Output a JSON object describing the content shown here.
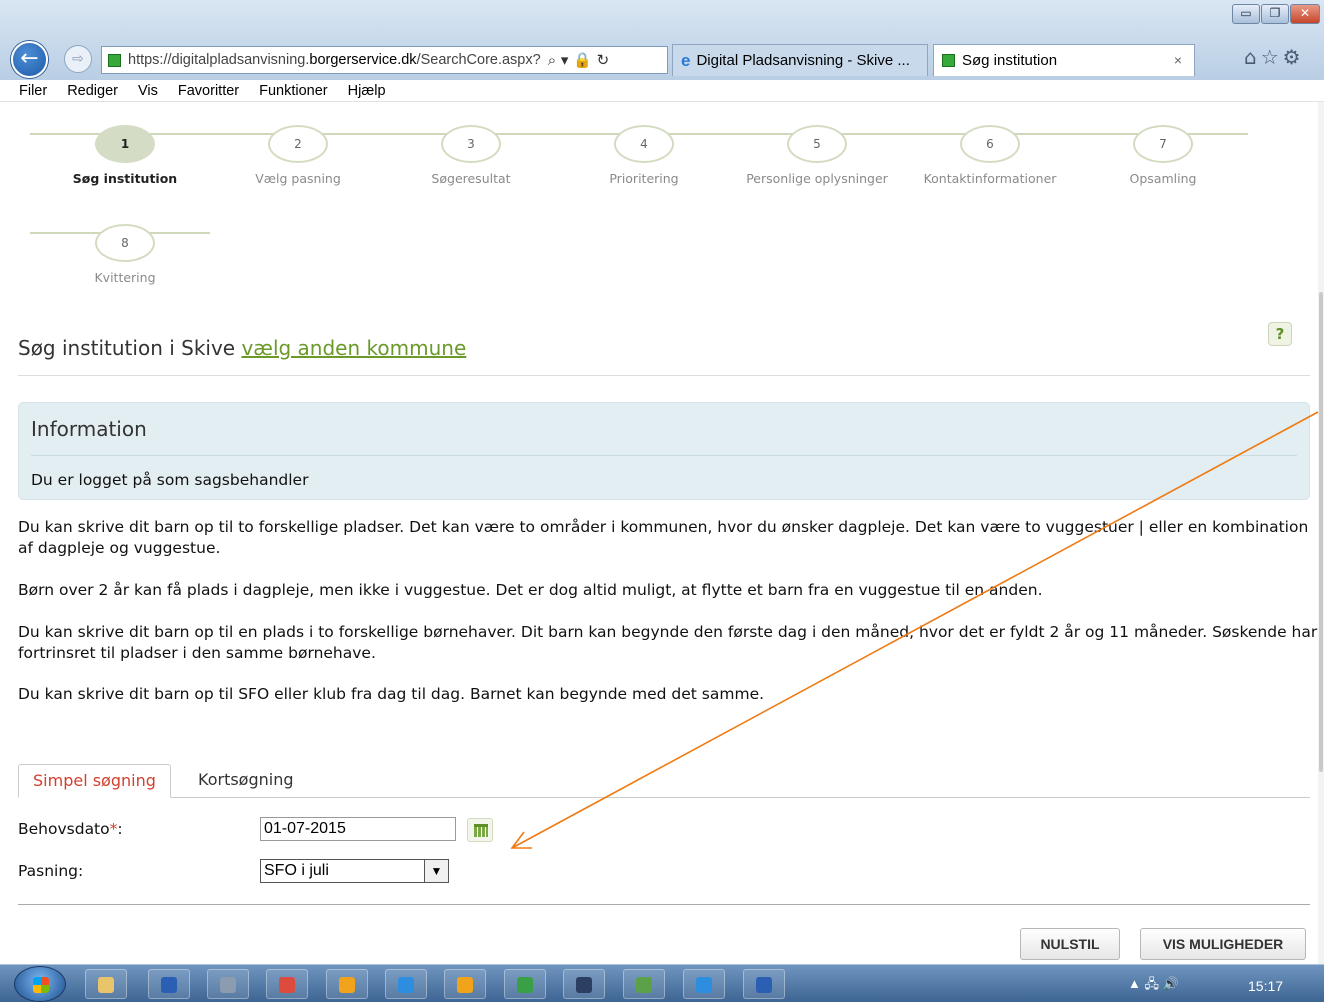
{
  "browser": {
    "url_prefix": "https://digitalpladsanvisning.",
    "url_domain": "borgerservice.dk",
    "url_suffix": "/SearchCore.aspx?",
    "tabs": [
      {
        "label": "Digital Pladsanvisning - Skive ..."
      },
      {
        "label": "Søg institution"
      }
    ],
    "tab_close": "×",
    "window_buttons": {
      "minimize": "▭",
      "maximize": "❐",
      "close": "✕"
    },
    "address_icons": "⌕ ▾ 🔒 ↻",
    "toolbar_icons": "⌂☆⚙",
    "back_glyph": "←",
    "forward_glyph": "⇨"
  },
  "menu": [
    "Filer",
    "Rediger",
    "Vis",
    "Favoritter",
    "Funktioner",
    "Hjælp"
  ],
  "steps": [
    {
      "number": "1",
      "label": "Søg institution",
      "active": true
    },
    {
      "number": "2",
      "label": "Vælg pasning",
      "active": false
    },
    {
      "number": "3",
      "label": "Søgeresultat",
      "active": false
    },
    {
      "number": "4",
      "label": "Prioritering",
      "active": false
    },
    {
      "number": "5",
      "label": "Personlige oplysninger",
      "active": false
    },
    {
      "number": "6",
      "label": "Kontaktinformationer",
      "active": false
    },
    {
      "number": "7",
      "label": "Opsamling",
      "active": false
    },
    {
      "number": "8",
      "label": "Kvittering",
      "active": false
    }
  ],
  "heading": {
    "text": "Søg institution i Skive ",
    "link": "vælg anden kommune"
  },
  "help_icon": "?",
  "info": {
    "title": "Information",
    "text": "Du er logget på som sagsbehandler"
  },
  "paragraphs": [
    "Du kan skrive dit barn op til to forskellige pladser. Det kan være to områder i kommunen, hvor du ønsker dagpleje. Det kan være to vuggestuer | eller en kombination af dagpleje og vuggestue.",
    "Børn over 2 år kan få plads i dagpleje, men ikke i vuggestue. Det er dog altid muligt, at flytte et barn fra en vuggestue til en anden.",
    "Du kan skrive dit barn op til en plads i to forskellige børnehaver. Dit barn kan begynde den første dag i den måned, hvor det er fyldt 2 år og 11 måneder. Søskende har fortrinsret til pladser i den samme børnehave.",
    "Du kan skrive dit barn op til SFO eller klub fra dag til dag. Barnet kan begynde med det samme."
  ],
  "search_tabs": {
    "simple": "Simpel søgning",
    "map": "Kortsøgning"
  },
  "form": {
    "date_label": "Behovsdato",
    "required_mark": "*",
    "date_colon": ":",
    "date_value": "01-07-2015",
    "care_label": "Pasning:",
    "care_value": "SFO i juli",
    "dropdown_arrow": "▼"
  },
  "buttons": {
    "reset": "NULSTIL",
    "show": "VIS MULIGHEDER"
  },
  "colors": {
    "accent_green": "#6b9a2b",
    "required_red": "#d2402e",
    "annotation_orange": "#f07a12",
    "info_bg": "#e3eef2"
  },
  "taskbar": {
    "tray_icons": "▲ 🖧 🔊",
    "clock": "15:17",
    "apps": [
      "file-explorer",
      "powershell",
      "network",
      "chrome",
      "outlook",
      "internet-explorer",
      "outlook",
      "lync",
      "remote-desktop",
      "notepad",
      "internet-explorer",
      "word"
    ],
    "app_colors": [
      "#e8c56a",
      "#2b5fb4",
      "#8b9bb0",
      "#dd4b3e",
      "#f0a31b",
      "#2d8ee0",
      "#f0a31b",
      "#3aa047",
      "#2c3e62",
      "#5aa14a",
      "#2d8ee0",
      "#2b5fb4"
    ]
  }
}
